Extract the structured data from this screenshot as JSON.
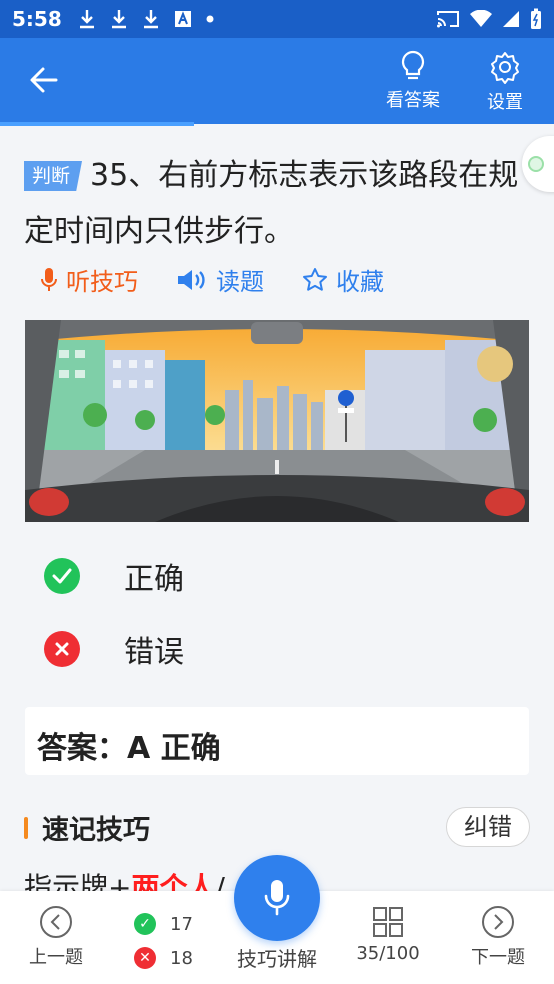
{
  "status": {
    "time": "5:58"
  },
  "header": {
    "show_answer_label": "看答案",
    "settings_label": "设置"
  },
  "question": {
    "tag": "判断",
    "text": "35、右前方标志表示该路段在规定时间内只供步行。"
  },
  "actions": {
    "listen": "听技巧",
    "read": "读题",
    "favorite": "收藏"
  },
  "options": [
    {
      "label": "正确",
      "status": "correct"
    },
    {
      "label": "错误",
      "status": "wrong"
    }
  ],
  "answer": {
    "text": "答案：A 正确"
  },
  "tips": {
    "title": "速记技巧",
    "correct_button": "纠错",
    "text_prefix": "指示牌+",
    "text_highlight": "两个人",
    "text_suffix": "/"
  },
  "bottom": {
    "prev": "上一题",
    "correct_count": "17",
    "wrong_count": "18",
    "explain": "技巧讲解",
    "progress": "35/100",
    "next": "下一题"
  },
  "colors": {
    "header": "#2b7be6",
    "status_bar": "#1a5fc7",
    "correct": "#21c35a",
    "wrong": "#ef2e34",
    "accent_orange": "#f25d1a",
    "accent_blue": "#2f80ed"
  }
}
